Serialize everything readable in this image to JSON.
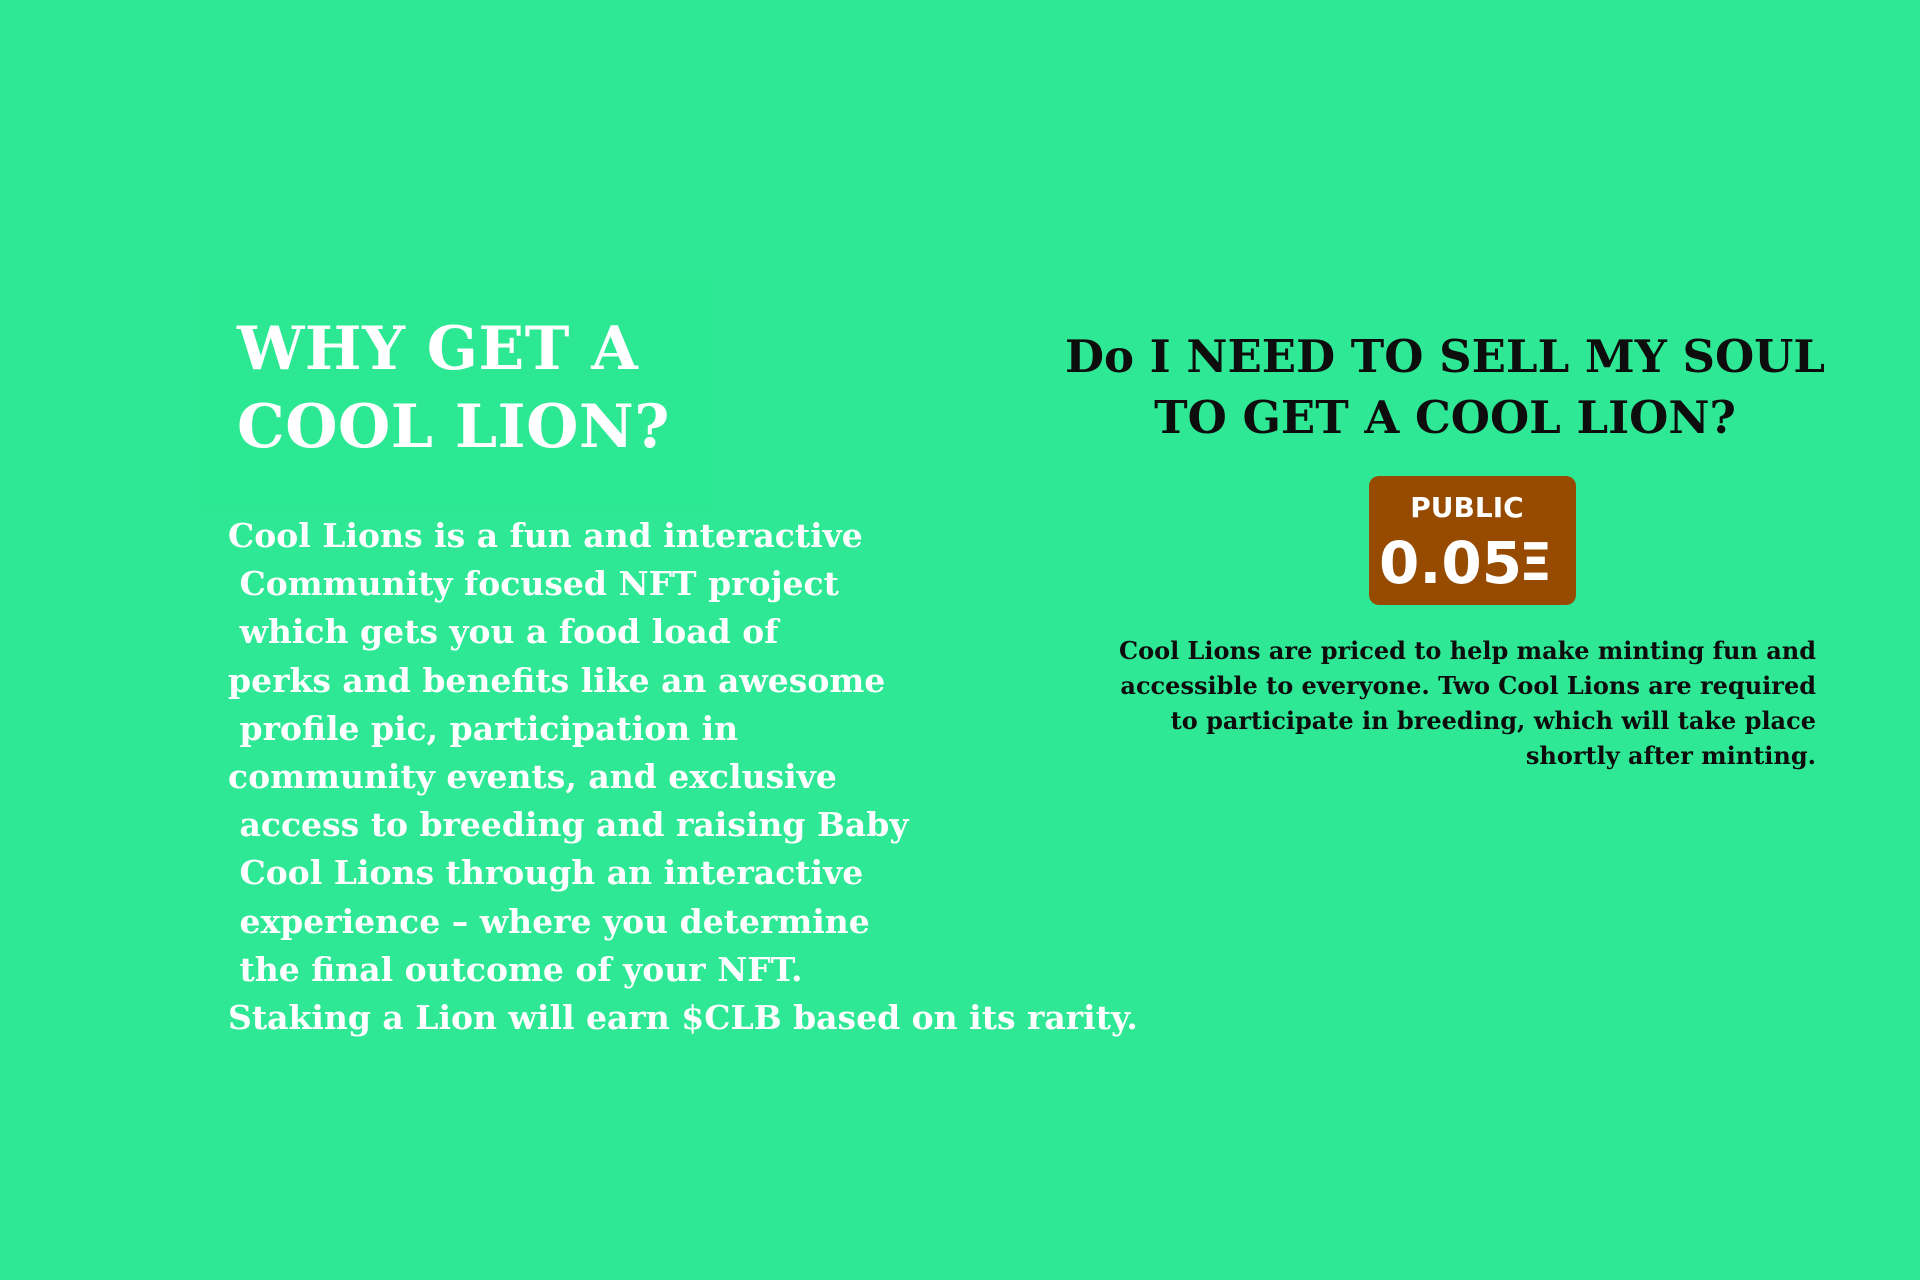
{
  "left": {
    "title_lines": [
      "WHY GET A",
      "COOL LION?"
    ],
    "body_lines": [
      "Cool Lions is a fun and interactive",
      " Community focused NFT project",
      " which gets you a food load of",
      "perks and benefits like an awesome",
      " profile pic, participation in",
      "community events, and exclusive",
      " access to breeding and raising Baby",
      " Cool Lions through an interactive",
      " experience – where you determine",
      " the final outcome of your NFT.",
      "Staking a Lion will earn $CLB based on its rarity."
    ]
  },
  "right": {
    "title_lines": [
      "Do I NEED TO SELL MY SOUL",
      "TO GET A COOL LION?"
    ],
    "price_badge": {
      "label": "PUBLIC",
      "price": "0.05",
      "currency_symbol": "Ξ",
      "color": "#964b00"
    },
    "body_lines": [
      "Cool Lions are priced to help make minting fun and",
      "accessible to everyone. Two Cool Lions are required",
      "to participate in breeding, which will take place",
      "shortly after minting."
    ]
  },
  "colors": {
    "background": "#2ee895",
    "left_text": "#ffffff",
    "right_text": "#0d0d0d"
  }
}
